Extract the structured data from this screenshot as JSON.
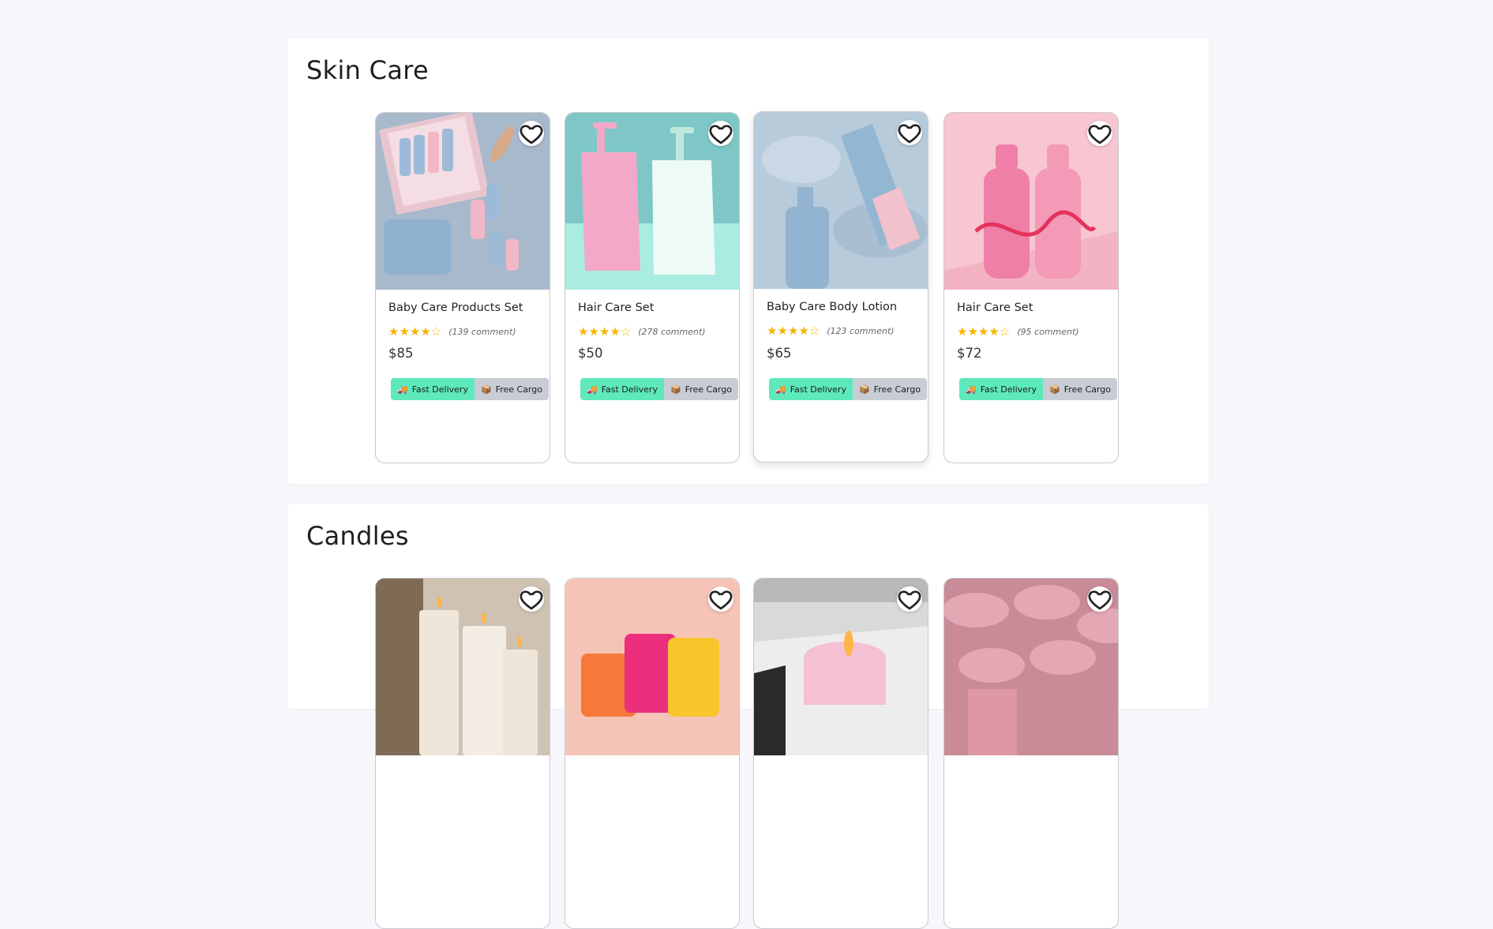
{
  "sections": [
    {
      "title": "Skin Care",
      "products": [
        {
          "name": "Baby Care Products Set",
          "stars": "★★★★☆",
          "comments": "(139 comment)",
          "price": "$85"
        },
        {
          "name": "Hair Care Set",
          "stars": "★★★★☆",
          "comments": "(278 comment)",
          "price": "$50"
        },
        {
          "name": "Baby Care Body Lotion",
          "stars": "★★★★☆",
          "comments": "(123 comment)",
          "price": "$65"
        },
        {
          "name": "Hair Care Set",
          "stars": "★★★★☆",
          "comments": "(95 comment)",
          "price": "$72"
        }
      ]
    },
    {
      "title": "Candles",
      "products": [
        {
          "image": "candle-pillars-photo"
        },
        {
          "image": "candle-glass-jars-photo"
        },
        {
          "image": "lit-pink-candle-photo"
        },
        {
          "image": "pink-candle-jars-photo"
        }
      ]
    }
  ],
  "badges": {
    "fast_delivery": "Fast Delivery",
    "free_cargo": "Free Cargo"
  },
  "icons": {
    "favorite": "heart-outline-icon",
    "truck": "truck-icon",
    "box": "box-icon"
  },
  "colors": {
    "star": "#f5b400",
    "fast_delivery_bg": "#5ee9bd",
    "free_cargo_bg": "#c8ccd4"
  }
}
